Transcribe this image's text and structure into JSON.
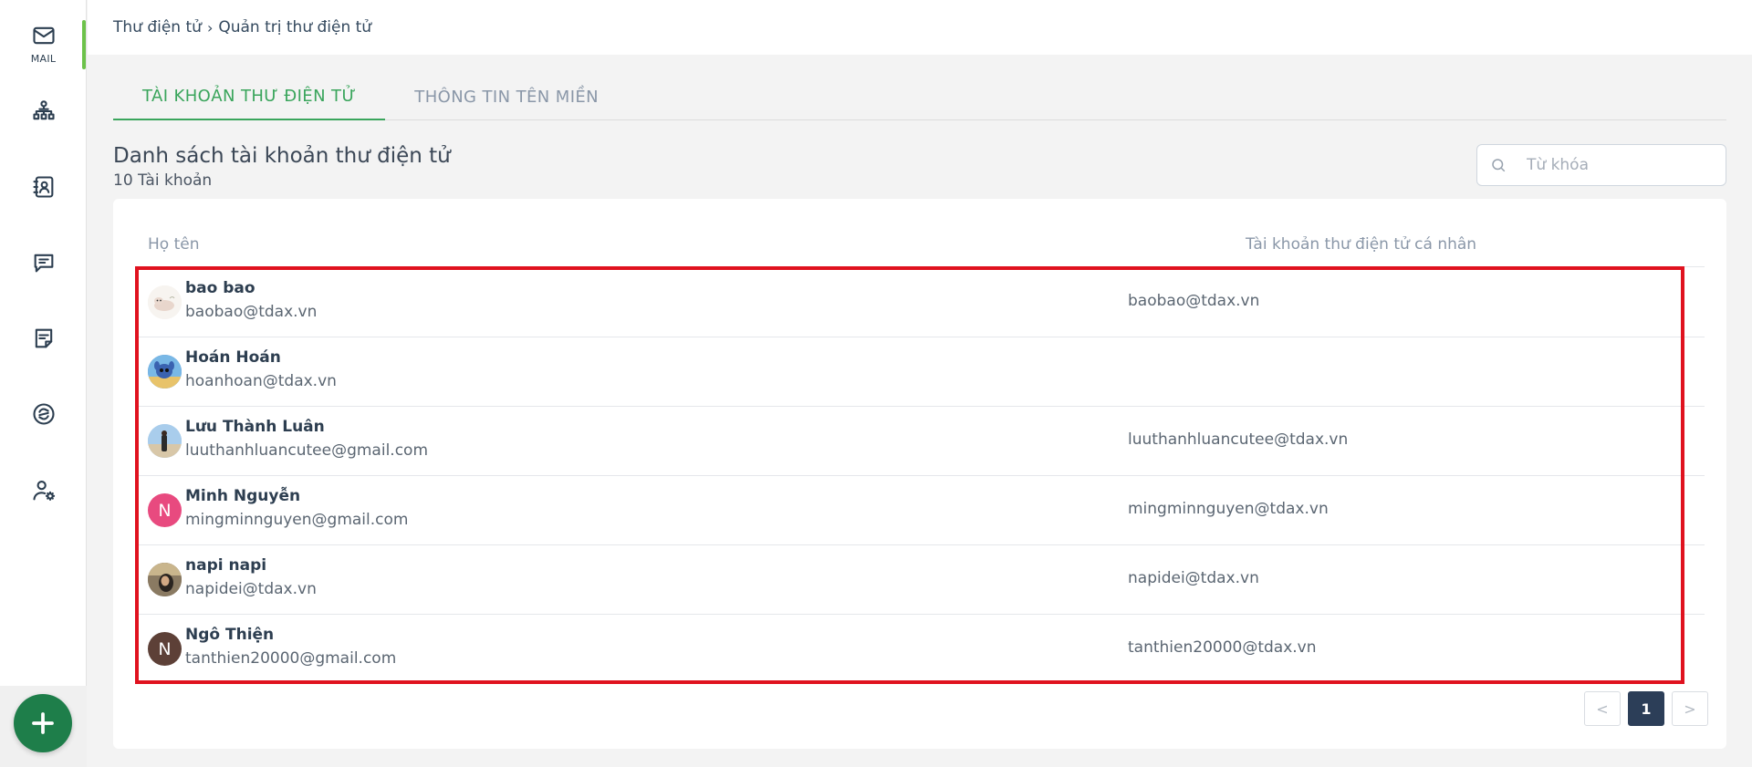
{
  "sidebar": {
    "mail_label": "MAIL",
    "icons": [
      "mail-icon",
      "org-chart-icon",
      "contacts-icon",
      "chat-icon",
      "notes-icon",
      "security-icon",
      "user-settings-icon"
    ]
  },
  "breadcrumb": {
    "root": "Thư điện tử",
    "separator": "›",
    "current": "Quản trị thư điện tử"
  },
  "tabs": [
    {
      "label": "TÀI KHOẢN THƯ ĐIỆN TỬ",
      "active": true
    },
    {
      "label": "THÔNG TIN TÊN MIỀN",
      "active": false
    }
  ],
  "list": {
    "title": "Danh sách tài khoản thư điện tử",
    "count": "10 Tài khoản"
  },
  "search": {
    "placeholder": "Từ khóa"
  },
  "table": {
    "columns": [
      "Họ tên",
      "Tài khoản thư điện tử cá nhân"
    ],
    "rows": [
      {
        "name": "bao bao",
        "email": "baobao@tdax.vn",
        "account": "baobao@tdax.vn",
        "avatar": "photo"
      },
      {
        "name": "Hoán Hoán",
        "email": "hoanhoan@tdax.vn",
        "account": "",
        "avatar": "photo"
      },
      {
        "name": "Lưu Thành Luân",
        "email": "luuthanhluancutee@gmail.com",
        "account": "luuthanhluancutee@tdax.vn",
        "avatar": "photo"
      },
      {
        "name": "Minh Nguyễn",
        "email": "mingminnguyen@gmail.com",
        "account": "mingminnguyen@tdax.vn",
        "avatar": "N",
        "avatar_color": "#e84a7f"
      },
      {
        "name": "napi napi",
        "email": "napidei@tdax.vn",
        "account": "napidei@tdax.vn",
        "avatar": "photo"
      },
      {
        "name": "Ngô Thiện",
        "email": "tanthien20000@gmail.com",
        "account": "tanthien20000@tdax.vn",
        "avatar": "N",
        "avatar_color": "#5d4037"
      }
    ]
  },
  "pagination": {
    "prev": "<",
    "current": "1",
    "next": ">"
  },
  "colors": {
    "accent": "#3aa55c",
    "fab": "#1e7e4a",
    "highlight": "#e0121f",
    "page_active": "#2c3e58"
  }
}
